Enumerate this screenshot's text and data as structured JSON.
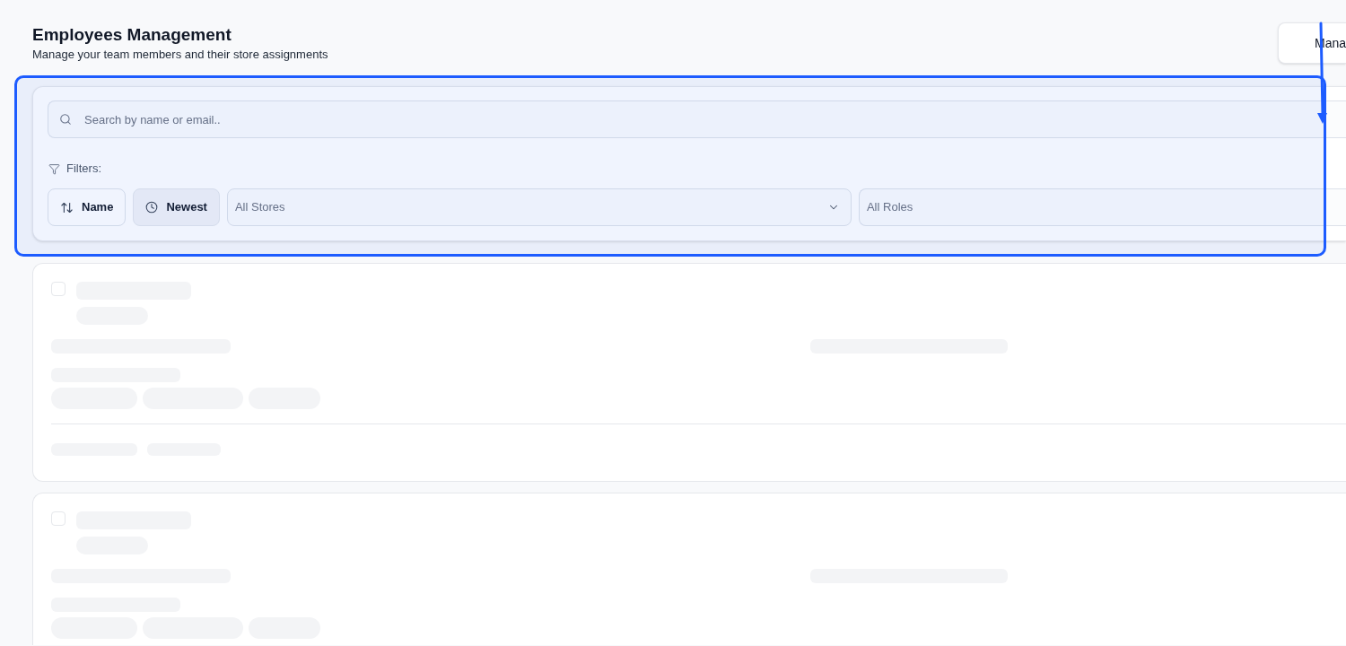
{
  "header": {
    "title": "Employees Management",
    "subtitle": "Manage your team members and their store assignments",
    "action_button": "Mana"
  },
  "filters": {
    "search": {
      "placeholder": "Search by name or email.."
    },
    "label": "Filters:",
    "sort_buttons": [
      {
        "kind": "alphabetical",
        "label": "Name",
        "selected": false
      },
      {
        "kind": "date",
        "label": "Newest",
        "selected": true
      }
    ],
    "selects": [
      {
        "value": "All Stores"
      },
      {
        "value": "All Roles"
      }
    ]
  },
  "skeleton_cards": [
    {
      "checked": false
    },
    {
      "checked": false
    }
  ]
}
